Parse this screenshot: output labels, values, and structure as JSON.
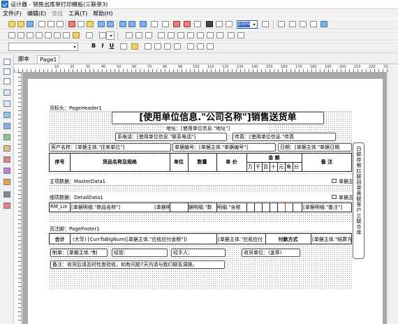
{
  "window": {
    "title": "设计器 - 销售出库单打印模板(三联单3)"
  },
  "menu": [
    "文件(F)",
    "编辑(E)",
    "查找",
    "工具(T)",
    "帮助(H)"
  ],
  "toolbar": {
    "zoom": "100%"
  },
  "format": {
    "bold": "B",
    "italic": "I",
    "underline": "U"
  },
  "tabs": [
    "脚本",
    "Page1"
  ],
  "ruler": [
    "10",
    "20",
    "30",
    "40",
    "50",
    "60",
    "70",
    "80",
    "90",
    "100",
    "110",
    "120",
    "130",
    "140",
    "150",
    "160",
    "170",
    "180",
    "190",
    "200",
    "210",
    "220",
    "230"
  ],
  "bands": {
    "page_header": "页标头：PageHeader1",
    "master": "主项数据：MasterData1",
    "detail": "细项数据：DetailData1",
    "footer": "页注脚：PageFooter1"
  },
  "header": {
    "title": "[使用单位信息.\"公司名称\"]销售送货单",
    "address": "地址：[使用单位信息.\"地址\"]",
    "phone": "系电话：[使用单位信息.\"联系电话\"]",
    "fax": "传真：[使用单位信息.\"传真",
    "customer": "客户名称：[单据主体.\"往来单位\"]",
    "doc_no": "单据编号：[单据主体.\"单据编号\"]",
    "date": "日期：[单据主体.\"单据日期"
  },
  "table_head": {
    "no": "序号",
    "name": "货品名称及规格",
    "unit": "单位",
    "qty": "数量",
    "price": "单 价",
    "amount": "金 额",
    "digits": [
      "万",
      "千",
      "百",
      "十",
      "元",
      "角",
      "分"
    ],
    "remark": "备 注"
  },
  "master_right": "单据主",
  "detail_right": "单据主",
  "detail_row": {
    "c1": "RM_Lin",
    "c2": "[单据明细.\"商品名称\"]",
    "c3": "[单据明细.\"明细.",
    "c4": "据明细.\"数",
    "c5": "明细.\"含税",
    "c6": "[单据明细.\"备注\"]"
  },
  "footer": {
    "total_label": "合计",
    "total_big": "(大写) [CurrToBigNum([单据主体.\"应收应付金额\"])",
    "total_small": "[单据主体.\"应收应付",
    "payment_label": "付款方式",
    "payment_val": "[单据主体.\"结算方",
    "maker": "制单：[单据主体.\"制",
    "manager": "经管：",
    "handler": "经手人：",
    "receiver": "收货单位：(盖章)",
    "note": "备注：收货后请及时检查验收，如有问题7天内请与我们联系调换。"
  },
  "side": "白联存根 红联回单 黄联客户 兰联仓库"
}
